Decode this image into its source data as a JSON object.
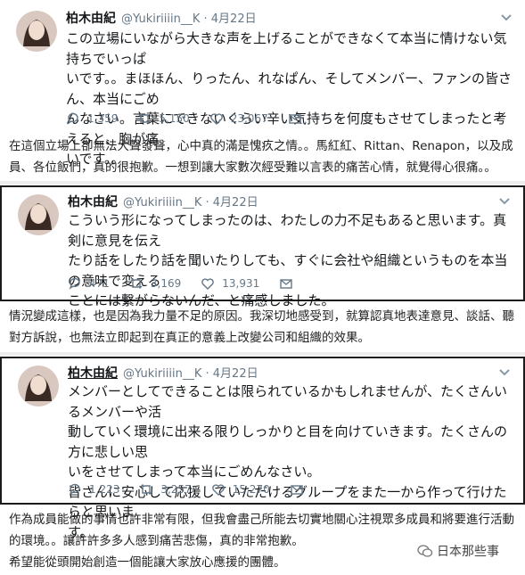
{
  "tweets": [
    {
      "display_name": "柏木由紀",
      "handle": "@Yukiriiiin__K · 4月22日",
      "text": "この立場にいながら大きな声を上げることができなくて本当に情けない気持ちでいっぱ\nいです。。まほほん、りったん、れなぱん、そしてメンバー、ファンの皆さん、本当にごめ\nんなさい。言葉にできないくらい辛い気持ちを何度もさせてしまったと考えると、胸が痛\nいです。。",
      "replies": "1,359",
      "retweets": "5,150",
      "likes": "23,067",
      "translation": "在這個立場上卻無法大聲發聲，心中真的滿是愧疚之情。。馬紅紅、Rittan、Renapon，以及成\n員、各位飯們，真的很抱歉。一想到讓大家數次經受難以言表的痛苦心情，就覺得心很痛。。"
    },
    {
      "display_name": "柏木由紀",
      "handle": "@Yukiriiiin__K · 4月22日",
      "text": "こういう形になってしまったのは、わたしの力不足もあると思います。真剣に意見を伝え\nたり話をしたり話を聞いたりしても、すぐに会社や組織というものを本当の意味で変える\nことには繋がらないんだ、と痛感しました。",
      "replies": "471",
      "retweets": "3,169",
      "likes": "13,931",
      "translation": "情況變成這樣，也是因為我力量不足的原因。我深切地感受到，就算認真地表達意見、談話、聽\n對方訴說，也無法立即起到在真正的意義上改變公司和組織的效果。"
    },
    {
      "display_name": "柏木由紀",
      "handle": "@Yukiriiiin__K · 4月22日",
      "text": "メンバーとしてできることは限られているかもしれませんが、たくさんいるメンバーや活\n動していく環境に出来る限りしっかりと目を向けていきます。たくさんの方に悲しい思\nいをさせてしまって本当にごめんなさい。\n皆さんに安心して応援していただけるグループをまた一から作って行けたらと思いま\nす。",
      "replies": "1,223",
      "retweets": "3,257",
      "likes": "15,270",
      "translation": "作為成員能做的事情也許非常有限，但我會盡己所能去切實地關心注視眾多成員和將要進行活動\n的環境。。讓許許多多人感到痛苦悲傷，真的非常抱歉。\n希望能從頭開始創造一個能讓大家放心應援的團體。"
    }
  ],
  "watermark": "日本那些事",
  "colors": {
    "text": "#14171a",
    "muted": "#657786",
    "border": "#1b1b1b"
  },
  "icons": [
    "reply-icon",
    "retweet-icon",
    "like-icon",
    "message-icon",
    "chevron-down-icon",
    "wechat-icon"
  ]
}
